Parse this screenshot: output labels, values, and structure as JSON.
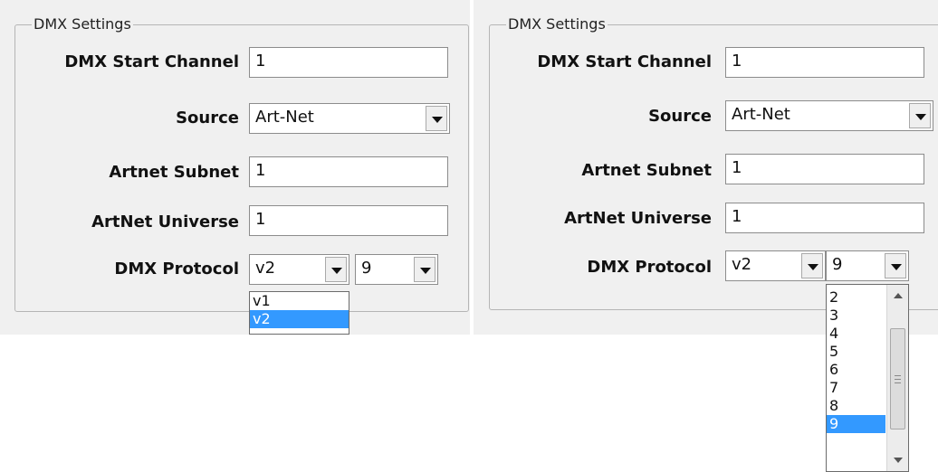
{
  "left": {
    "group_title": "DMX Settings",
    "labels": {
      "start_channel": "DMX Start Channel",
      "source": "Source",
      "subnet": "Artnet Subnet",
      "universe": "ArtNet Universe",
      "protocol": "DMX Protocol"
    },
    "values": {
      "start_channel": "1",
      "source": "Art-Net",
      "subnet": "1",
      "universe": "1",
      "protocol_version": "v2",
      "protocol_number": "9"
    },
    "dropdown": {
      "items": [
        "v1",
        "v2"
      ],
      "selected": "v2"
    }
  },
  "right": {
    "group_title": "DMX Settings",
    "labels": {
      "start_channel": "DMX Start Channel",
      "source": "Source",
      "subnet": "Artnet Subnet",
      "universe": "ArtNet Universe",
      "protocol": "DMX Protocol"
    },
    "values": {
      "start_channel": "1",
      "source": "Art-Net",
      "subnet": "1",
      "universe": "1",
      "protocol_version": "v2",
      "protocol_number": "9"
    },
    "dropdown": {
      "items": [
        "2",
        "3",
        "4",
        "5",
        "6",
        "7",
        "8",
        "9"
      ],
      "selected": "9"
    }
  },
  "colors": {
    "panel": "#f0f0f0",
    "selection": "#3399ff",
    "border": "#8c8c8c"
  }
}
